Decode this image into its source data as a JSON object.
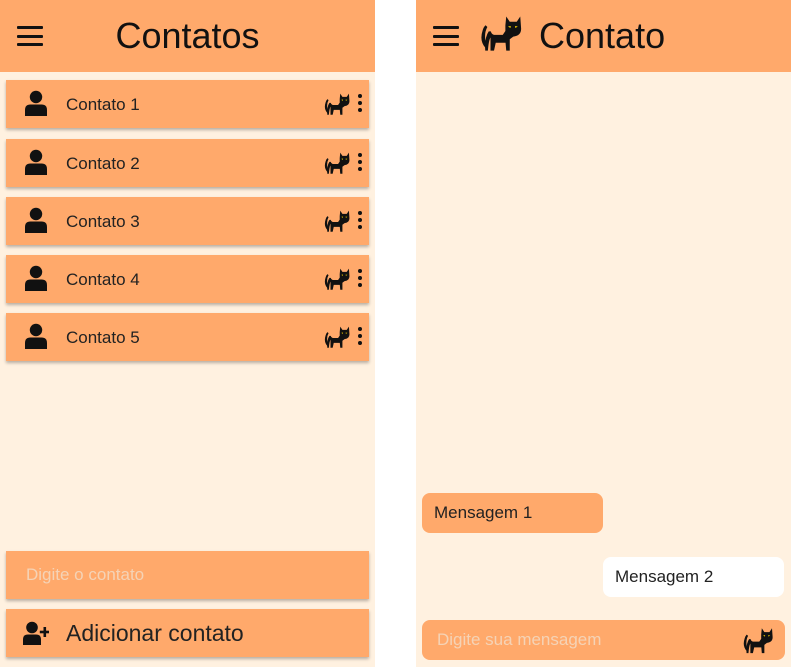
{
  "colors": {
    "appbar": "#ffa96b",
    "background": "#fff1e0",
    "received_bubble": "#ffa96b",
    "sent_bubble": "#ffffff",
    "placeholder": "#f5d3b6",
    "text": "#222222"
  },
  "contacts_screen": {
    "menu_icon": "hamburger-menu-icon",
    "title": "Contatos",
    "contacts": [
      {
        "name": "Contato 1",
        "avatar_icon": "person-icon",
        "action_icon": "cat-icon",
        "menu_icon": "more-vertical-icon"
      },
      {
        "name": "Contato 2",
        "avatar_icon": "person-icon",
        "action_icon": "cat-icon",
        "menu_icon": "more-vertical-icon"
      },
      {
        "name": "Contato 3",
        "avatar_icon": "person-icon",
        "action_icon": "cat-icon",
        "menu_icon": "more-vertical-icon"
      },
      {
        "name": "Contato 4",
        "avatar_icon": "person-icon",
        "action_icon": "cat-icon",
        "menu_icon": "more-vertical-icon"
      },
      {
        "name": "Contato 5",
        "avatar_icon": "person-icon",
        "action_icon": "cat-icon",
        "menu_icon": "more-vertical-icon"
      }
    ],
    "contact_input": {
      "placeholder": "Digite o contato",
      "value": ""
    },
    "add_button": {
      "label": "Adicionar contato",
      "icon": "add-person-icon"
    }
  },
  "chat_screen": {
    "menu_icon": "hamburger-menu-icon",
    "header_icon": "cat-icon",
    "title": "Contato",
    "messages": [
      {
        "text": "Mensagem 1",
        "side": "received"
      },
      {
        "text": "Mensagem 2",
        "side": "sent"
      }
    ],
    "message_input": {
      "placeholder": "Digite sua mensagem",
      "value": ""
    },
    "send_icon": "cat-icon"
  }
}
